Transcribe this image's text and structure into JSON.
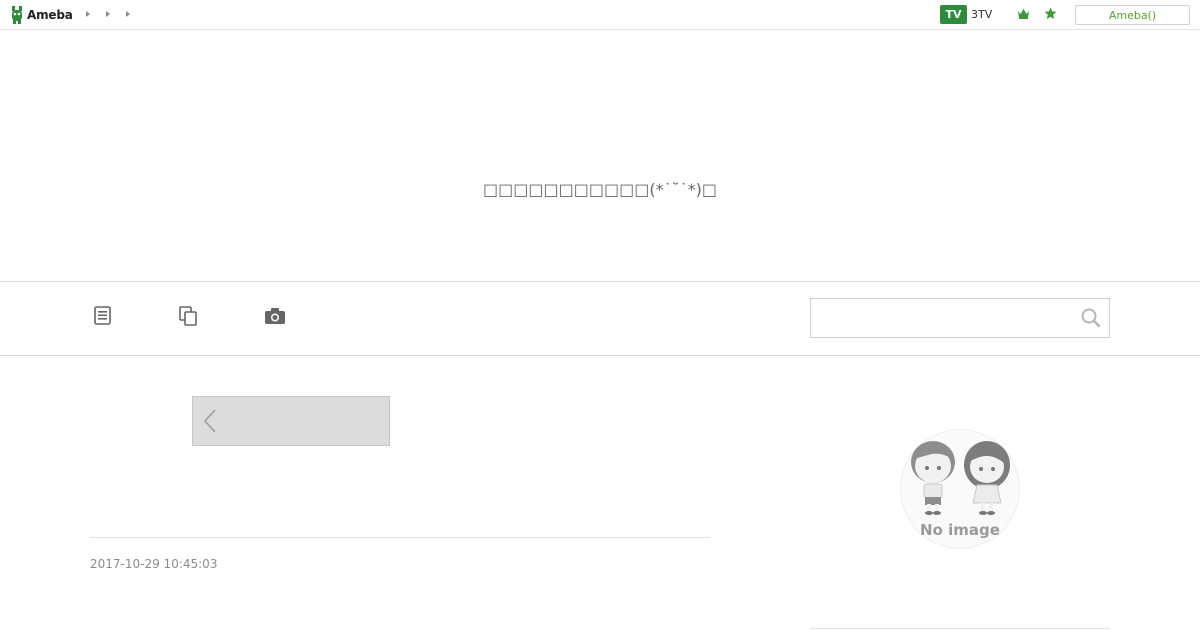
{
  "topbar": {
    "logo_text": "Ameba",
    "tv_badge": "TV",
    "tv_label": "3TV",
    "ameba_button": "Ameba()"
  },
  "header": {
    "blog_title": "□□□□□□□□□□□(*˙˘˙*)□"
  },
  "nav": {
    "icons": [
      "list-icon",
      "copy-icon",
      "camera-icon"
    ],
    "search": {
      "placeholder": "",
      "value": ""
    }
  },
  "entry": {
    "date": "2017-10-29 10:45:03"
  },
  "sidebar": {
    "profile_image_text": "No image"
  },
  "colors": {
    "brand_green": "#2d8c3c",
    "accent_green": "#5aa432"
  }
}
